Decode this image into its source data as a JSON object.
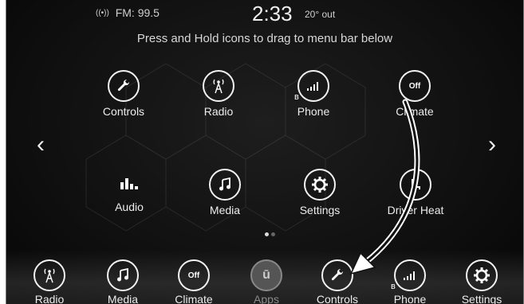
{
  "status": {
    "radio": "FM: 99.5",
    "time": "2:33",
    "temp": "20° out"
  },
  "hint": "Press and Hold icons to drag to menu bar below",
  "nav": {
    "prev": "‹",
    "next": "›"
  },
  "apps": [
    {
      "label": "Controls"
    },
    {
      "label": "Radio"
    },
    {
      "label": "Phone"
    },
    {
      "label": "Climate",
      "badge": "Off"
    },
    {
      "label": "Audio"
    },
    {
      "label": "Media"
    },
    {
      "label": "Settings"
    },
    {
      "label": "Driver Heat"
    }
  ],
  "menu_bar": [
    {
      "label": "Radio"
    },
    {
      "label": "Media"
    },
    {
      "label": "Climate",
      "badge": "Off"
    },
    {
      "label": "Apps"
    },
    {
      "label": "Controls"
    },
    {
      "label": "Phone"
    },
    {
      "label": "Settings"
    }
  ],
  "page_dots": {
    "count": 2,
    "active": 1
  }
}
